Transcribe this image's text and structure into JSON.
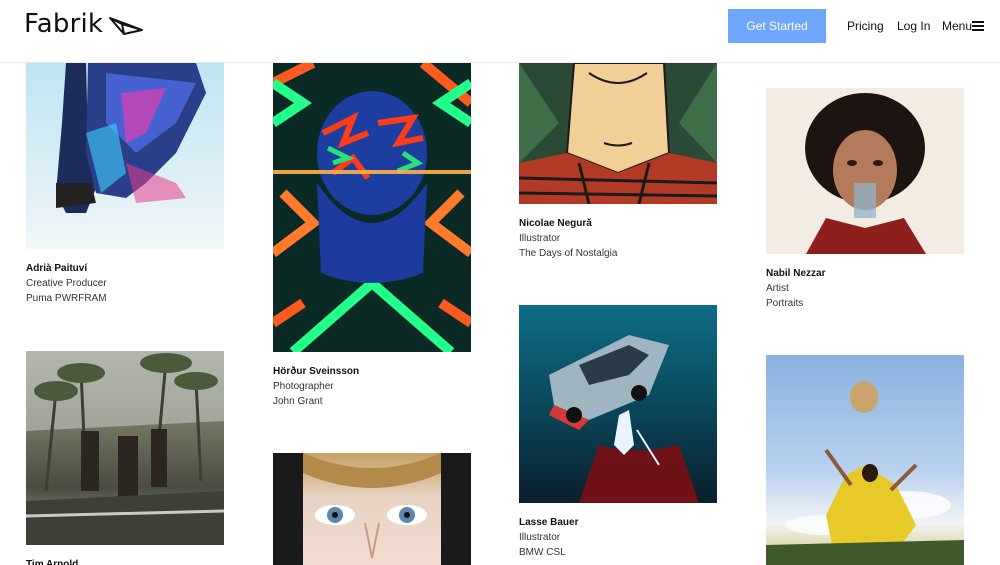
{
  "header": {
    "brand": "Fabrik",
    "cta_label": "Get Started",
    "nav": {
      "pricing": "Pricing",
      "login": "Log In",
      "menu": "Menu"
    }
  },
  "cards": [
    {
      "name": "Adrià Paituví",
      "role": "Creative Producer",
      "project": "Puma PWRFRAM"
    },
    {
      "name": "Tim Arnold",
      "role": "",
      "project": ""
    },
    {
      "name": "Hörður Sveinsson",
      "role": "Photographer",
      "project": "John Grant"
    },
    {
      "name": "Nicolae Negură",
      "role": "Illustrator",
      "project": "The Days of Nostalgia"
    },
    {
      "name": "Lasse Bauer",
      "role": "Illustrator",
      "project": "BMW CSL"
    },
    {
      "name": "Nabil Nezzar",
      "role": "Artist",
      "project": "Portraits"
    }
  ],
  "colors": {
    "accent": "#6ea6fb",
    "text": "#111111"
  }
}
